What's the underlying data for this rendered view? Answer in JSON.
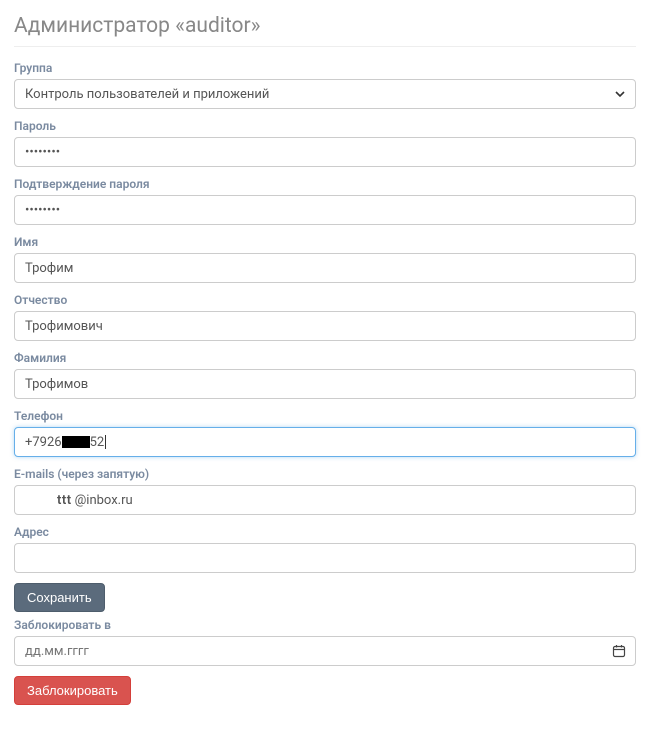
{
  "page": {
    "title": "Администратор «auditor»"
  },
  "form": {
    "group": {
      "label": "Группа",
      "value": "Контроль пользователей и приложений"
    },
    "password": {
      "label": "Пароль",
      "value": "••••••••"
    },
    "password_confirm": {
      "label": "Подтверждение пароля",
      "value": "••••••••"
    },
    "first_name": {
      "label": "Имя",
      "value": "Трофим"
    },
    "patronymic": {
      "label": "Отчество",
      "value": "Трофимович"
    },
    "last_name": {
      "label": "Фамилия",
      "value": "Трофимов"
    },
    "phone": {
      "label": "Телефон",
      "prefix": "+7926",
      "suffix": "52"
    },
    "emails": {
      "label": "E-mails (через запятую)",
      "local": "ttt",
      "domain": "@inbox.ru"
    },
    "address": {
      "label": "Адрес",
      "value": ""
    },
    "save_button": "Сохранить",
    "block_at": {
      "label": "Заблокировать в",
      "placeholder": "дд.мм.гггг"
    },
    "block_button": "Заблокировать"
  }
}
